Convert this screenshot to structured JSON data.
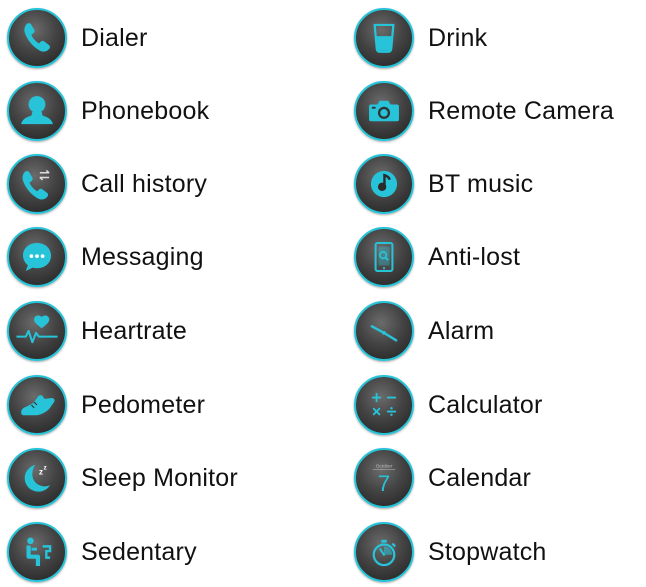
{
  "accent_color": "#27c3d8",
  "icon_background": "#3d3d3d",
  "apps": [
    {
      "label": "Dialer",
      "icon": "phone-icon"
    },
    {
      "label": "Drink",
      "icon": "glass-icon"
    },
    {
      "label": "Phonebook",
      "icon": "contact-icon"
    },
    {
      "label": "Remote Camera",
      "icon": "camera-icon"
    },
    {
      "label": "Call history",
      "icon": "call-history-icon"
    },
    {
      "label": "BT music",
      "icon": "music-icon"
    },
    {
      "label": "Messaging",
      "icon": "chat-bubble-icon"
    },
    {
      "label": "Anti-lost",
      "icon": "phone-finder-icon"
    },
    {
      "label": "Heartrate",
      "icon": "heart-pulse-icon"
    },
    {
      "label": "Alarm",
      "icon": "clock-icon"
    },
    {
      "label": "Pedometer",
      "icon": "shoe-icon"
    },
    {
      "label": "Calculator",
      "icon": "calculator-icon"
    },
    {
      "label": "Sleep Monitor",
      "icon": "moon-icon"
    },
    {
      "label": "Calendar",
      "icon": "calendar-icon"
    },
    {
      "label": "Sedentary",
      "icon": "sitting-person-icon"
    },
    {
      "label": "Stopwatch",
      "icon": "stopwatch-icon"
    }
  ],
  "calendar_month_text": "October",
  "calendar_day_text": "7"
}
